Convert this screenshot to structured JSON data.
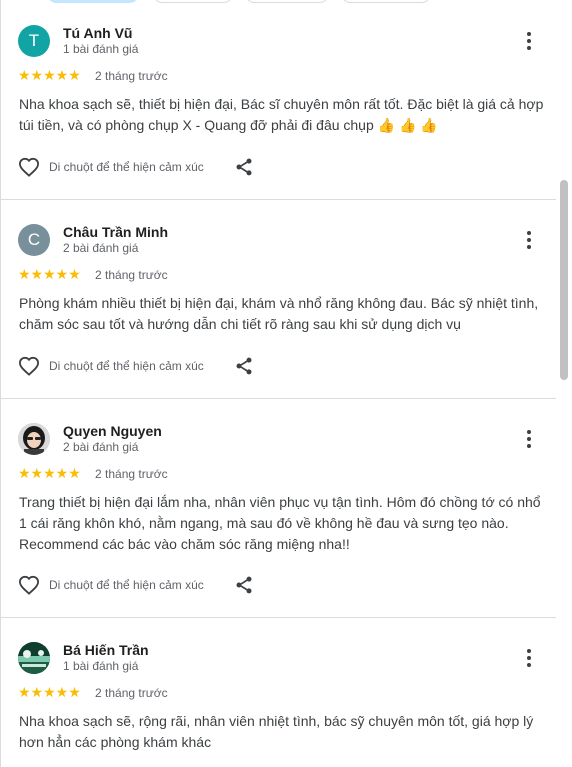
{
  "reaction_label": "Di chuột để thể hiện cảm xúc",
  "colors": {
    "star": "#fbbc04",
    "accent_chip": "#c2e7ff"
  },
  "reviews": [
    {
      "avatar_letter": "T",
      "avatar_color": "#12a4a4",
      "name": "Tú Anh Vũ",
      "count": "1 bài đánh giá",
      "stars": "★★★★★",
      "rating": 5,
      "time": "2 tháng trước",
      "text": "Nha khoa sạch sẽ, thiết bị hiện đại, Bác sĩ chuyên môn rất tốt. Đặc biệt là giá cả hợp túi tiền, và có phòng chụp X - Quang đỡ phải đi đâu chụp 👍 👍 👍"
    },
    {
      "avatar_letter": "C",
      "avatar_color": "#78909c",
      "name": "Châu Trần Minh",
      "count": "2 bài đánh giá",
      "stars": "★★★★★",
      "rating": 5,
      "time": "2 tháng trước",
      "text": "Phòng khám nhiều thiết bị hiện đại, khám và nhổ răng không đau. Bác sỹ nhiệt tình, chăm sóc sau tốt và hướng dẫn chi tiết rõ ràng sau khi sử dụng dịch vụ"
    },
    {
      "avatar_letter": "",
      "avatar_color": "#9e9e9e",
      "name": "Quyen Nguyen",
      "count": "2 bài đánh giá",
      "stars": "★★★★★",
      "rating": 5,
      "time": "2 tháng trước",
      "text": "Trang thiết bị hiện đại lắm nha, nhân viên phục vụ tận tình. Hôm đó chồng tớ có nhổ 1 cái răng khôn khó, nằm ngang, mà sau đó về không hề đau và sưng tẹo nào. Recommend các bác vào chăm sóc răng miệng nha!!"
    },
    {
      "avatar_letter": "",
      "avatar_color": "#2e7d60",
      "name": "Bá Hiến Trần",
      "count": "1 bài đánh giá",
      "stars": "★★★★★",
      "rating": 5,
      "time": "2 tháng trước",
      "text": "Nha khoa sạch sẽ, rộng rãi, nhân viên nhiệt tình, bác sỹ chuyên môn tốt, giá hợp lý hơn hẳn các phòng khám khác"
    }
  ]
}
